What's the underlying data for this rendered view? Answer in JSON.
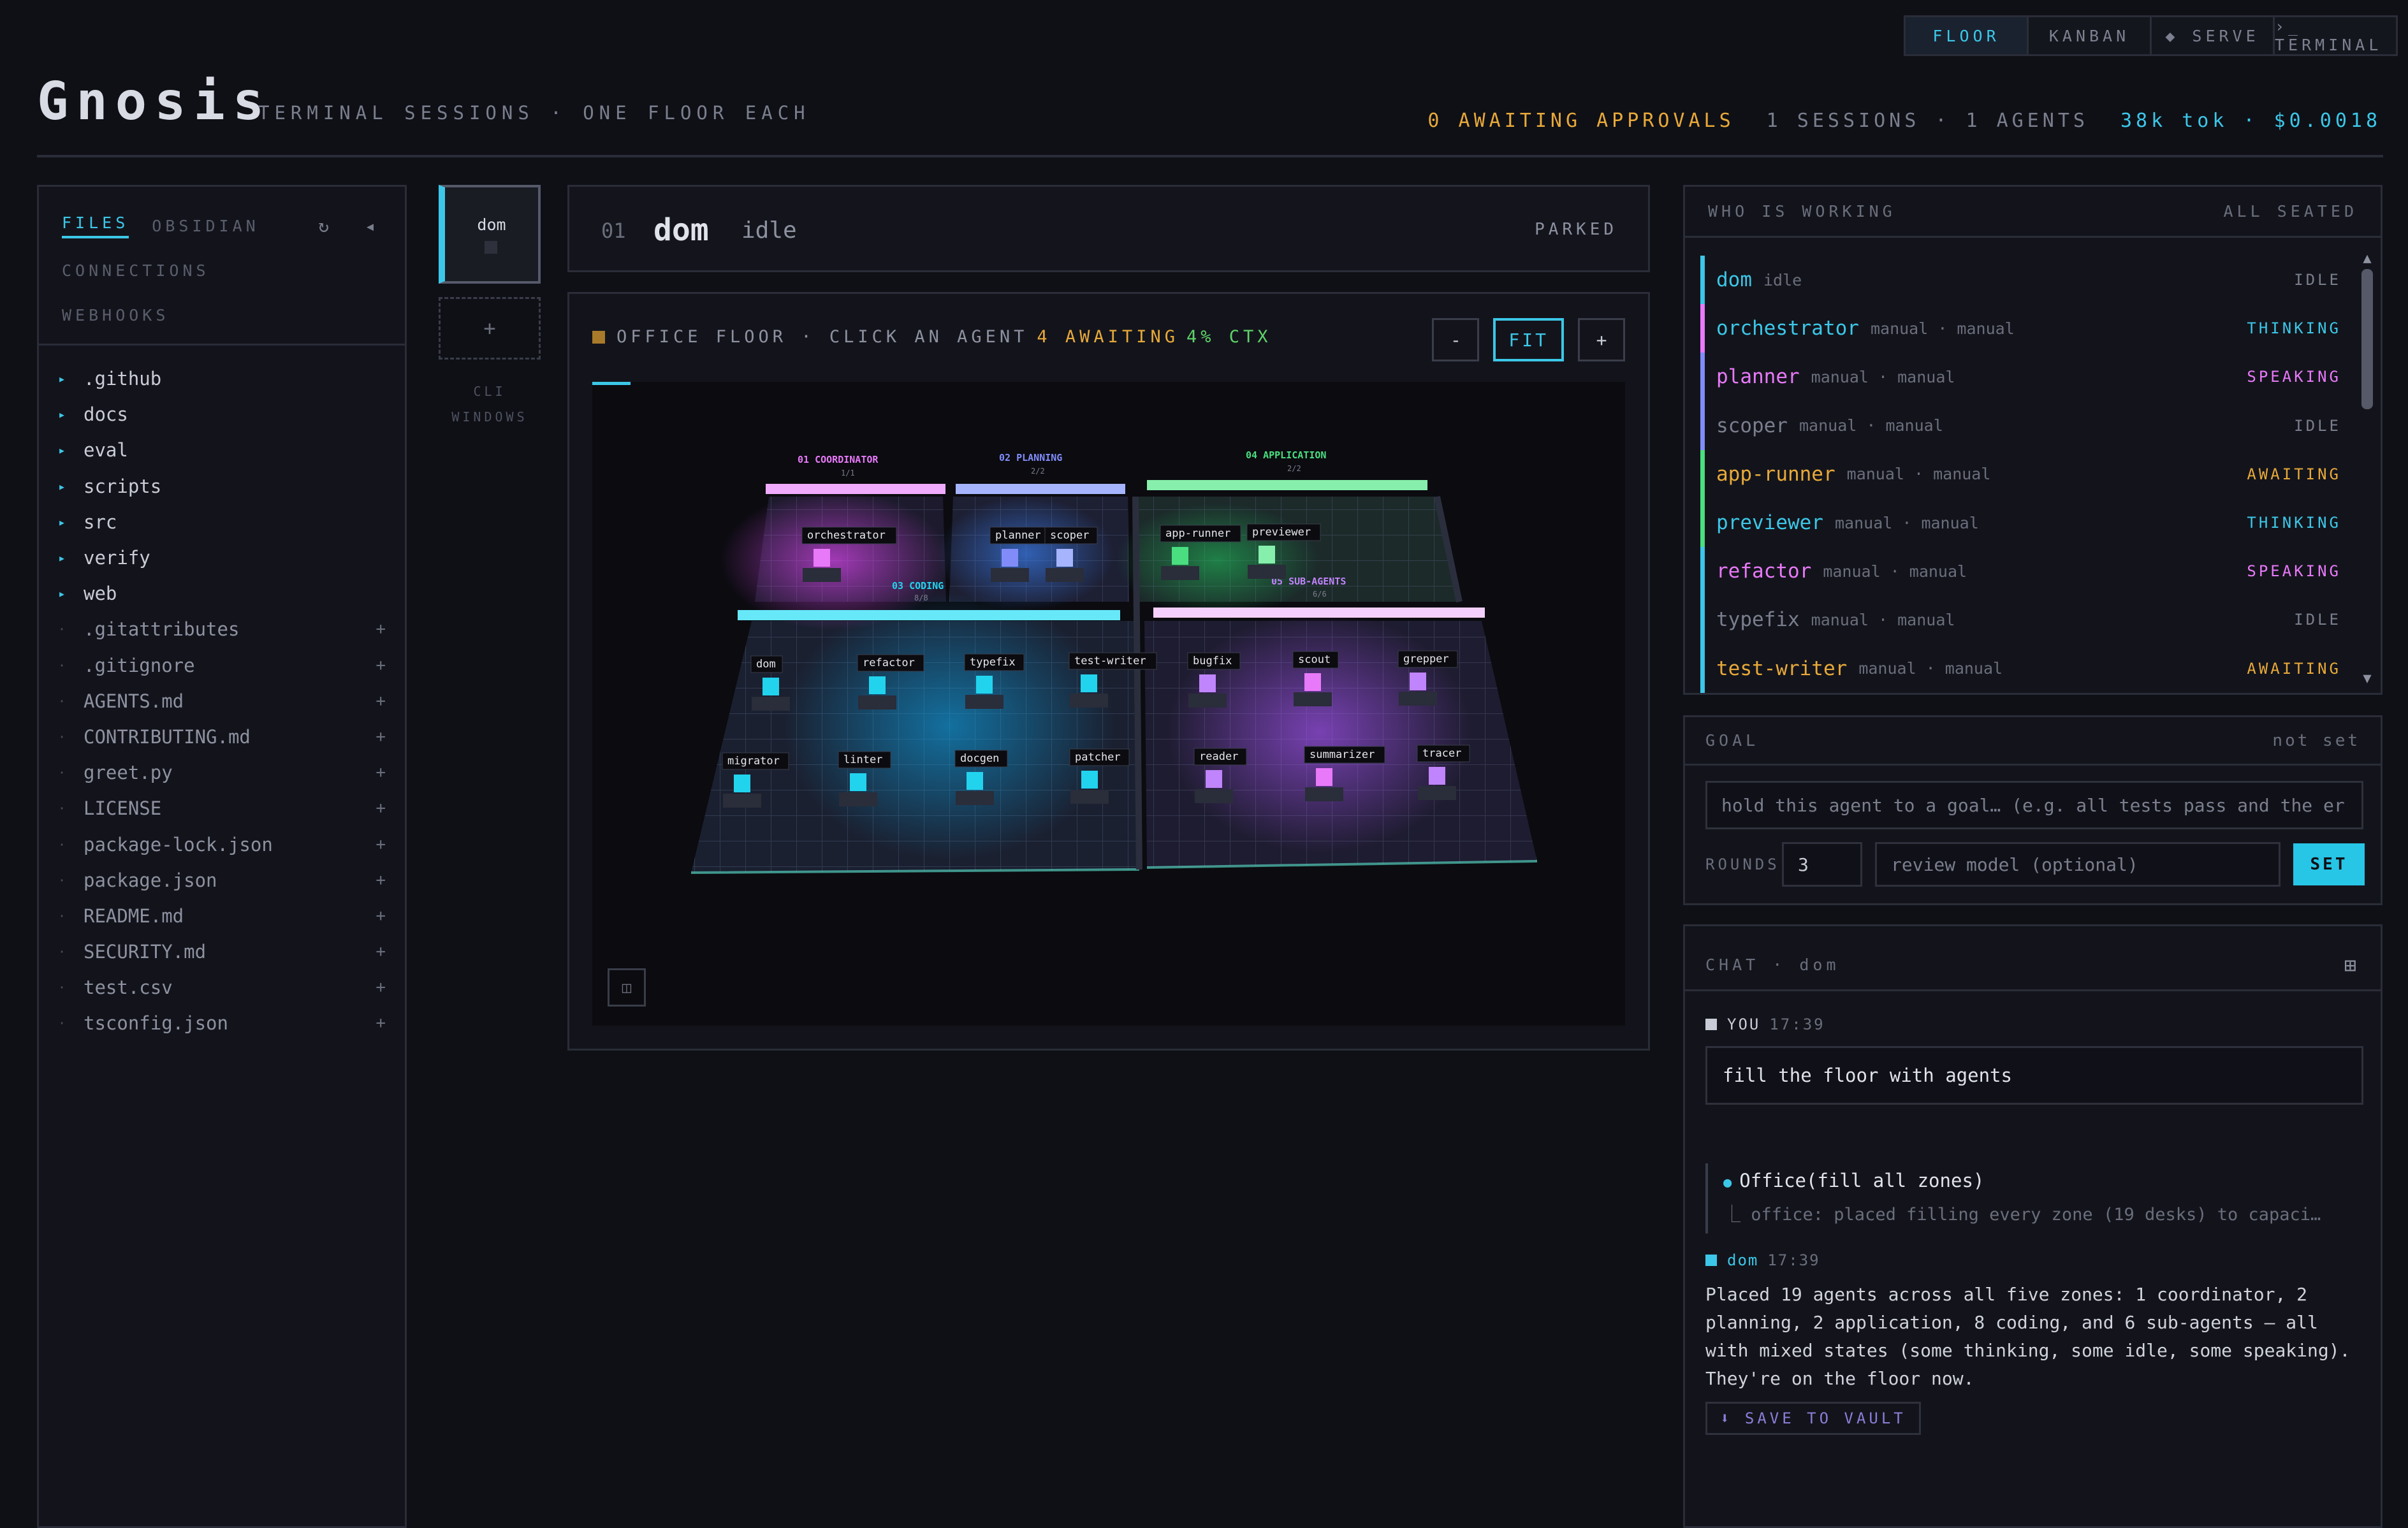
{
  "nav": {
    "tabs": [
      "FLOOR",
      "KANBAN",
      "◆ SERVE",
      "›_ TERMINAL"
    ]
  },
  "brand": {
    "title": "Gnosis",
    "subtitle": "TERMINAL SESSIONS · ONE FLOOR EACH"
  },
  "stats": {
    "awaiting": "0 AWAITING APPROVALS",
    "sessions": "1 SESSIONS · 1 AGENTS",
    "tokens": "38k tok · $0.0018"
  },
  "left": {
    "tabs": [
      "FILES",
      "OBSIDIAN"
    ],
    "links": [
      "CONNECTIONS",
      "WEBHOOKS"
    ],
    "folders": [
      ".github",
      "docs",
      "eval",
      "scripts",
      "src",
      "verify",
      "web"
    ],
    "files": [
      ".gitattributes",
      ".gitignore",
      "AGENTS.md",
      "CONTRIBUTING.md",
      "greet.py",
      "LICENSE",
      "package-lock.json",
      "package.json",
      "README.md",
      "SECURITY.md",
      "test.csv",
      "tsconfig.json"
    ]
  },
  "sessions": {
    "current": "dom",
    "cli_windows": "CLI WINDOWS"
  },
  "session_header": {
    "num": "01",
    "name": "dom",
    "status": "idle",
    "state": "PARKED"
  },
  "floor": {
    "label": "OFFICE FLOOR · CLICK AN AGENT",
    "awaiting": "4 AWAITING",
    "ctx": "4% CTX",
    "zoom_out": "-",
    "fit": "FIT",
    "zoom_in": "+",
    "zones": [
      {
        "name": "01 COORDINATOR",
        "count": "1/1",
        "color": "#e879f9"
      },
      {
        "name": "02 PLANNING",
        "count": "2/2",
        "color": "#818cf8"
      },
      {
        "name": "04 APPLICATION",
        "count": "2/2",
        "color": "#4ade80"
      },
      {
        "name": "03 CODING",
        "count": "8/8",
        "color": "#22d3ee"
      },
      {
        "name": "05 SUB-AGENTS",
        "count": "6/6",
        "color": "#c084fc"
      }
    ],
    "agents": [
      "orchestrator",
      "planner",
      "scoper",
      "app-runner",
      "previewer",
      "dom",
      "refactor",
      "typefix",
      "test-writer",
      "migrator",
      "linter",
      "docgen",
      "patcher",
      "bugfix",
      "scout",
      "grepper",
      "reader",
      "summarizer",
      "tracer"
    ]
  },
  "who": {
    "title": "WHO IS WORKING",
    "summary": "ALL SEATED",
    "agents": [
      {
        "name": "dom",
        "meta": "idle",
        "state": "IDLE",
        "name_color": "#3cc7e8",
        "bar": "#3cc7e8",
        "state_color": "#7a7e8d"
      },
      {
        "name": "orchestrator",
        "meta": "manual · manual",
        "state": "THINKING",
        "name_color": "#3cc7e8",
        "bar": "#e879f9",
        "state_color": "#3cc7e8"
      },
      {
        "name": "planner",
        "meta": "manual · manual",
        "state": "SPEAKING",
        "name_color": "#e879f9",
        "bar": "#818cf8",
        "state_color": "#e879f9"
      },
      {
        "name": "scoper",
        "meta": "manual · manual",
        "state": "IDLE",
        "name_color": "#7a7e8d",
        "bar": "#818cf8",
        "state_color": "#7a7e8d"
      },
      {
        "name": "app-runner",
        "meta": "manual · manual",
        "state": "AWAITING",
        "name_color": "#e8a93a",
        "bar": "#4ade80",
        "state_color": "#e8a93a"
      },
      {
        "name": "previewer",
        "meta": "manual · manual",
        "state": "THINKING",
        "name_color": "#3cc7e8",
        "bar": "#4ade80",
        "state_color": "#3cc7e8"
      },
      {
        "name": "refactor",
        "meta": "manual · manual",
        "state": "SPEAKING",
        "name_color": "#e879f9",
        "bar": "#3cc7e8",
        "state_color": "#e879f9"
      },
      {
        "name": "typefix",
        "meta": "manual · manual",
        "state": "IDLE",
        "name_color": "#7a7e8d",
        "bar": "#3cc7e8",
        "state_color": "#7a7e8d"
      },
      {
        "name": "test-writer",
        "meta": "manual · manual",
        "state": "AWAITING",
        "name_color": "#e8a93a",
        "bar": "#3cc7e8",
        "state_color": "#e8a93a"
      }
    ]
  },
  "goal": {
    "title": "GOAL",
    "status": "not set",
    "placeholder": "hold this agent to a goal… (e.g. all tests pass and the er",
    "rounds_label": "ROUNDS",
    "rounds": "3",
    "review_placeholder": "review model (optional)",
    "set": "SET"
  },
  "chat": {
    "title": "CHAT · dom",
    "you": "YOU",
    "you_time": "17:39",
    "user_msg": "fill the floor with agents",
    "tool_call": "Office(fill all zones)",
    "tool_result": "⎿ office: placed filling every zone (19 desks) to capaci…",
    "agent": "dom",
    "agent_time": "17:39",
    "reply": "Placed 19 agents across all five zones: 1 coordinator, 2 planning, 2 application, 8 coding, and 6 sub-agents — all with mixed states (some thinking, some idle, some speaking). They're on the floor now.",
    "save": "⬇ SAVE TO VAULT"
  }
}
